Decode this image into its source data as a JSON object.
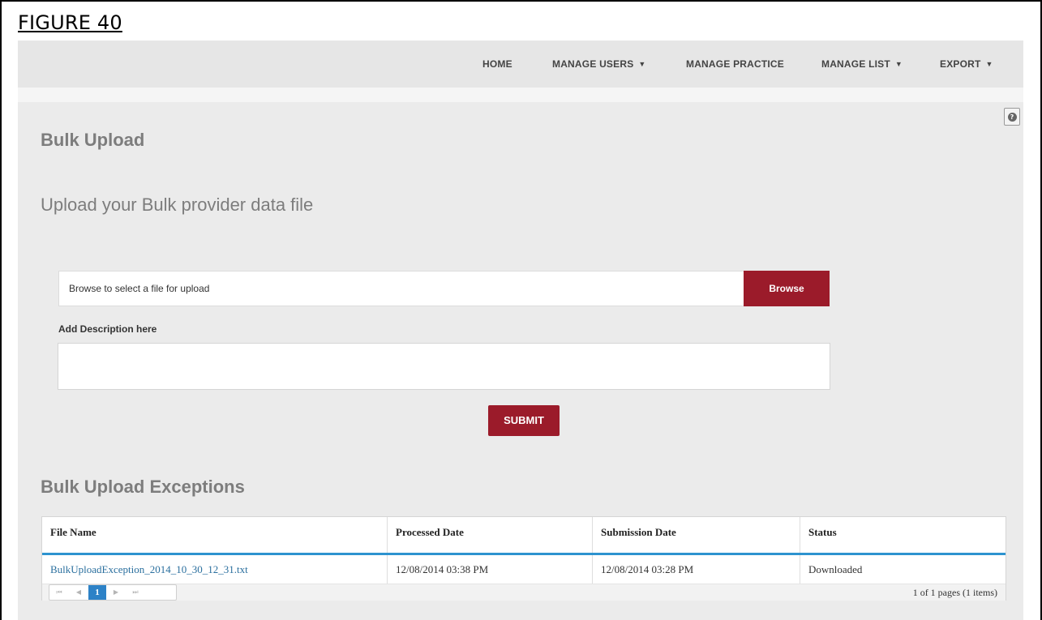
{
  "figure_label": "FIGURE 40",
  "nav": {
    "home": "HOME",
    "manage_users": "MANAGE USERS",
    "manage_practice": "MANAGE PRACTICE",
    "manage_list": "MANAGE LIST",
    "export": "EXPORT",
    "caret": "▼"
  },
  "page_title": "Bulk Upload",
  "upload": {
    "heading": "Upload your Bulk provider data file",
    "file_placeholder": "Browse to select a file for upload",
    "browse_label": "Browse",
    "description_label": "Add Description here",
    "description_value": "",
    "submit_label": "SUBMIT"
  },
  "exceptions": {
    "title": "Bulk Upload Exceptions",
    "columns": [
      "File Name",
      "Processed Date",
      "Submission Date",
      "Status"
    ],
    "rows": [
      {
        "file_name": "BulkUploadException_2014_10_30_12_31.txt",
        "processed_date": "12/08/2014 03:38 PM",
        "submission_date": "12/08/2014 03:28 PM",
        "status": "Downloaded"
      }
    ],
    "pager": {
      "first": "⏮",
      "prev": "◀",
      "current_page": "1",
      "next": "▶",
      "last": "⏭",
      "info": "1 of 1 pages (1 items)"
    }
  },
  "icons": {
    "help": "question-circle-icon"
  },
  "colors": {
    "brand_red": "#9b1b2a",
    "accent_blue": "#2d93cf",
    "link_blue": "#2a6f9e"
  }
}
